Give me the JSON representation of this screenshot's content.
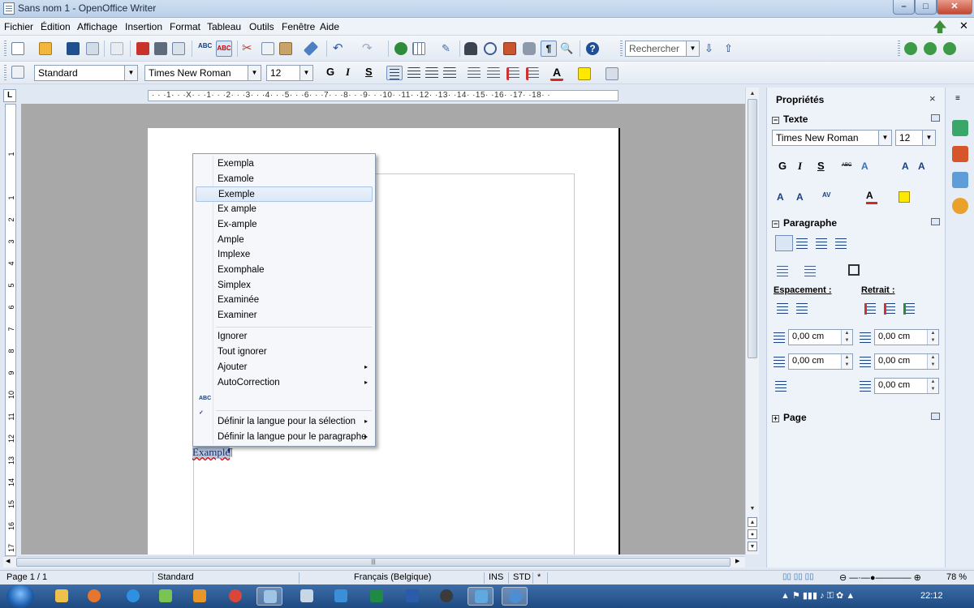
{
  "window": {
    "title": "Sans nom 1 - OpenOffice Writer"
  },
  "menu": [
    "Fichier",
    "Édition",
    "Affichage",
    "Insertion",
    "Format",
    "Tableau",
    "Outils",
    "Fenêtre",
    "Aide"
  ],
  "toolbar": {
    "search_placeholder": "Rechercher",
    "paragraph_style": "Standard",
    "font_name": "Times New Roman",
    "font_size": "12",
    "bold": "G",
    "italic": "I",
    "underline": "S"
  },
  "ruler": {
    "horizontal": "· · ·1· · ·X· · ·1· · ·2· · ·3· · ·4· · ·5· · ·6· · ·7· · ·8· · ·9· · ·10· ·11· ·12· ·13· ·14· ·15· ·16· ·17· ·18· ·",
    "vertical_numbers": [
      "1",
      "1",
      "2",
      "3",
      "4",
      "5",
      "6",
      "7",
      "8",
      "9",
      "10",
      "11",
      "12",
      "13",
      "14",
      "15",
      "16",
      "17"
    ]
  },
  "document": {
    "word": "Example",
    "pilcrow": "¶"
  },
  "context_menu": {
    "suggestions": [
      "Exempla",
      "Examole",
      "Exemple",
      "Ex ample",
      "Ex-ample",
      "Ample",
      "Implexe",
      "Exomphale",
      "Simplex",
      "Examinée",
      "Examiner"
    ],
    "highlighted_index": 2,
    "ignore": "Ignorer",
    "ignore_all": "Tout ignorer",
    "add": "Ajouter",
    "autocorrect": "AutoCorrection",
    "spelling_icon": "spellcheck-icon",
    "set_language_selection": "Définir la langue pour la sélection",
    "set_language_paragraph": "Définir la langue pour le paragraphe",
    "submenu_arrow": "▸"
  },
  "sidebar": {
    "title": "Propriétés",
    "close": "×",
    "text_section": "Texte",
    "font_name": "Times New Roman",
    "font_size": "12",
    "bold": "G",
    "italic": "I",
    "underline": "S",
    "paragraph_section": "Paragraphe",
    "spacing_label": "Espacement :",
    "indent_label": "Retrait :",
    "above_spacing": "0,00 cm",
    "below_spacing": "0,00 cm",
    "before_indent": "0,00 cm",
    "after_indent": "0,00 cm",
    "first_line_indent": "0,00 cm",
    "page_section": "Page"
  },
  "status": {
    "page": "Page 1 / 1",
    "style": "Standard",
    "language": "Français (Belgique)",
    "insert_mode": "INS",
    "selection_mode": "STD",
    "modified": "*",
    "zoom": "78 %"
  },
  "taskbar": {
    "time": "22:12"
  },
  "colors": {
    "accent": "#3a6fb0",
    "highlight": "#dce8f7",
    "doc_background": "#a8a8a8"
  }
}
